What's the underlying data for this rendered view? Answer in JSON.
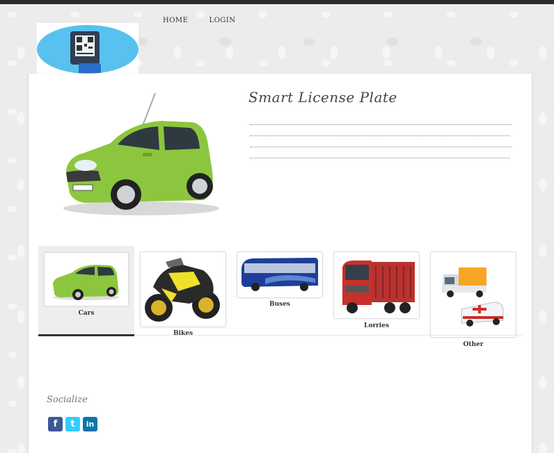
{
  "nav": {
    "home": "HOME",
    "login": "LOGIN"
  },
  "page": {
    "title": "Smart License Plate"
  },
  "categories": [
    {
      "label": "Cars"
    },
    {
      "label": "Bikes"
    },
    {
      "label": "Buses"
    },
    {
      "label": "Lorries"
    },
    {
      "label": "Other"
    }
  ],
  "social": {
    "title": "Socialize",
    "facebook": "f",
    "twitter": "t",
    "linkedin": "in"
  },
  "colors": {
    "car_green": "#8cc63f",
    "bus_blue": "#1d3f9a",
    "lorry_red": "#c9302c",
    "truck_orange": "#f6a623",
    "logo_blue": "#59c1ef",
    "facebook": "#3b5998",
    "twitter": "#33ccff",
    "linkedin": "#0e76a8"
  }
}
